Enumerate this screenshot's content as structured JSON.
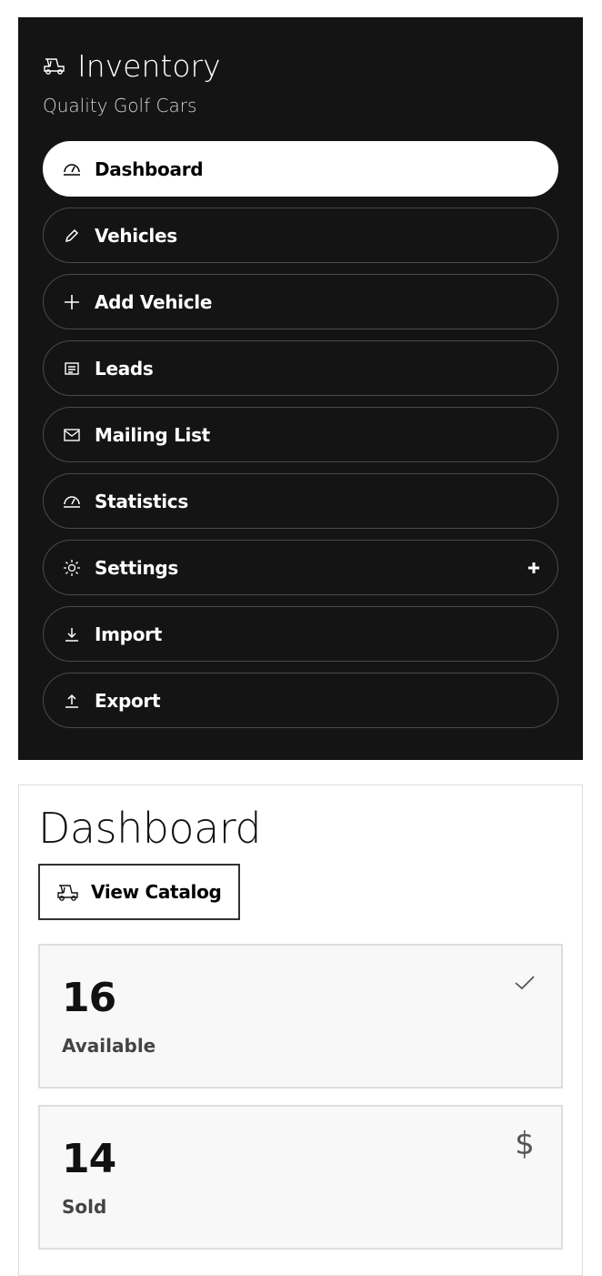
{
  "sidebar": {
    "title": "Inventory",
    "subtitle": "Quality Golf Cars",
    "items": [
      {
        "label": "Dashboard",
        "icon": "gauge-icon",
        "active": true
      },
      {
        "label": "Vehicles",
        "icon": "pencil-icon"
      },
      {
        "label": "Add Vehicle",
        "icon": "plus-icon"
      },
      {
        "label": "Leads",
        "icon": "list-icon"
      },
      {
        "label": "Mailing List",
        "icon": "mail-icon"
      },
      {
        "label": "Statistics",
        "icon": "gauge-icon"
      },
      {
        "label": "Settings",
        "icon": "sun-icon",
        "expandable": true
      },
      {
        "label": "Import",
        "icon": "download-icon"
      },
      {
        "label": "Export",
        "icon": "upload-icon"
      }
    ]
  },
  "main": {
    "title": "Dashboard",
    "view_catalog_label": "View Catalog",
    "stats": [
      {
        "value": "16",
        "label": "Available",
        "icon": "check-icon"
      },
      {
        "value": "14",
        "label": "Sold",
        "icon": "dollar-icon",
        "symbol": "$"
      }
    ]
  },
  "colors": {
    "sidebar_bg": "#141414",
    "active_item_bg": "#ffffff",
    "card_bg": "#f8f8f8"
  }
}
